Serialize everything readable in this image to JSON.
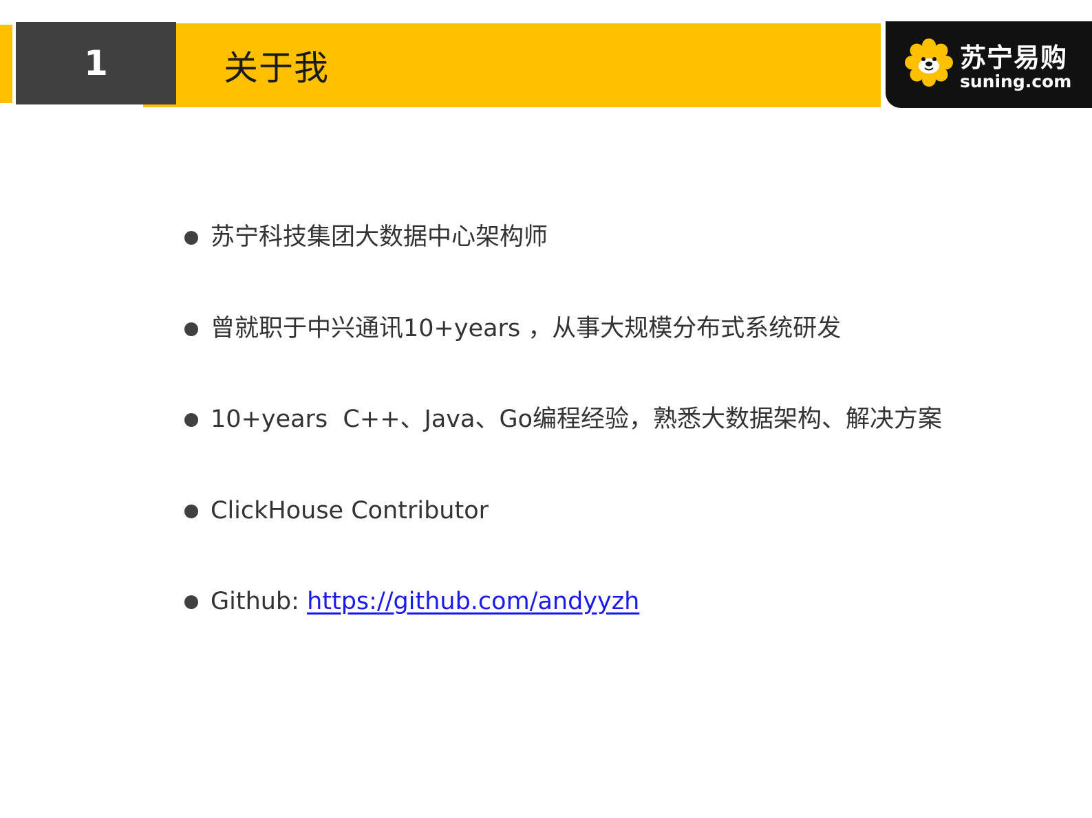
{
  "header": {
    "section_number": "1",
    "title": "关于我"
  },
  "logo": {
    "icon": "lion-mascot-icon",
    "brand_cn": "苏宁易购",
    "brand_en": "suning.com"
  },
  "bullets": [
    {
      "text": "苏宁科技集团大数据中心架构师"
    },
    {
      "text": "曾就职于中兴通讯10+years ，从事大规模分布式系统研发"
    },
    {
      "text": "10+years  C++、Java、Go编程经验，熟悉大数据架构、解决方案"
    },
    {
      "text": "ClickHouse Contributor"
    },
    {
      "label": "Github: ",
      "link": "https://github.com/andyyzh"
    }
  ],
  "colors": {
    "accent_yellow": "#FFC000",
    "number_box": "#404040",
    "logo_bg": "#111111",
    "link": "#1a1aee"
  }
}
